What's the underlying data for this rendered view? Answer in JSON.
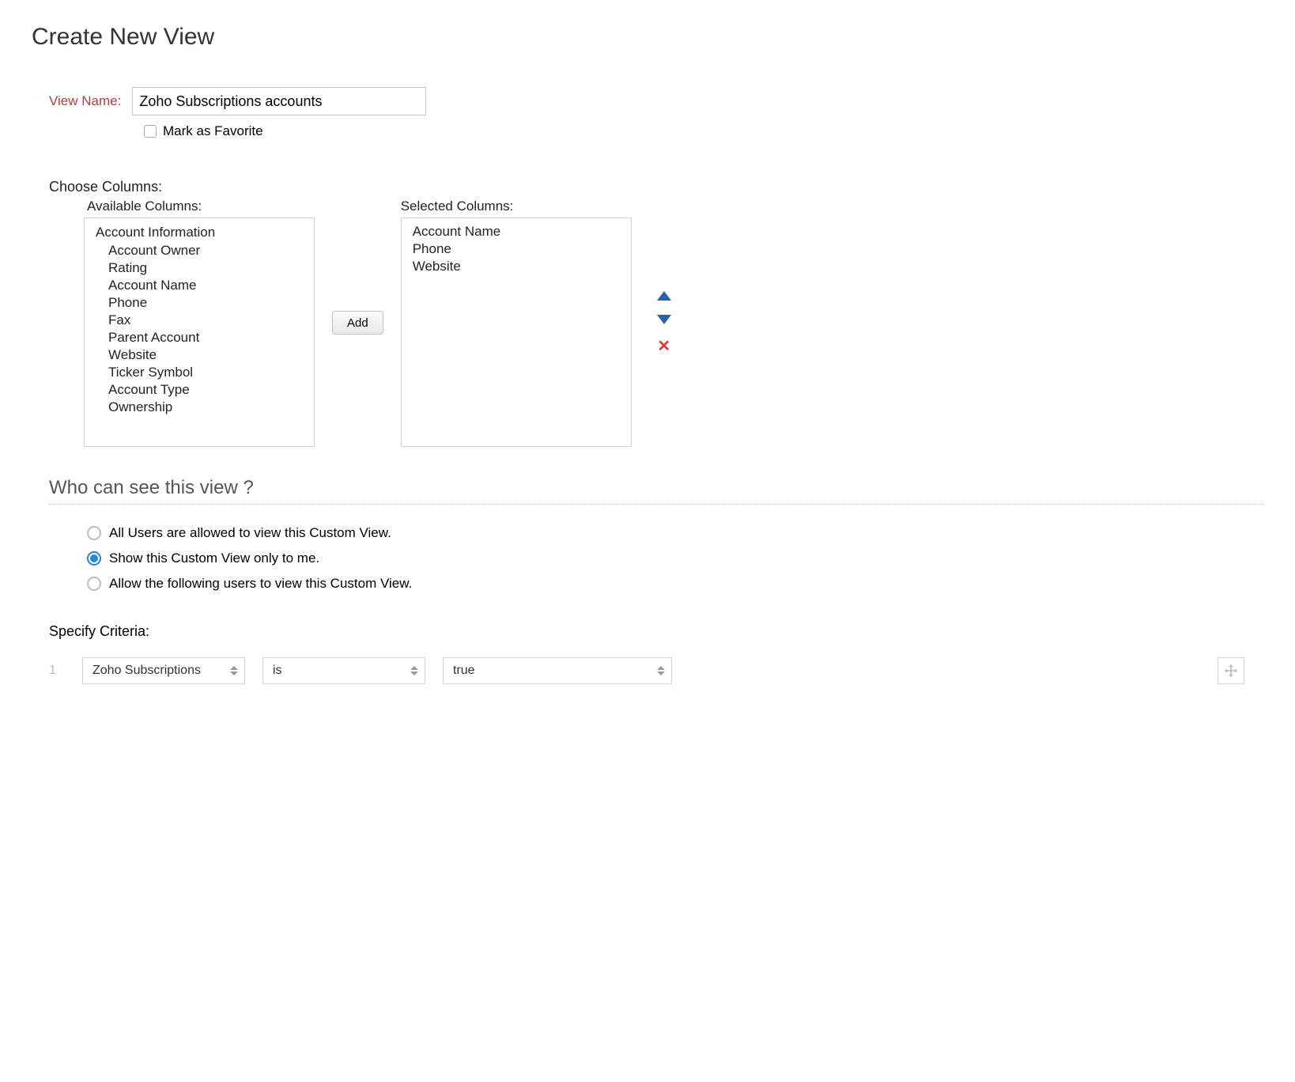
{
  "page_title": "Create New View",
  "view_name": {
    "label": "View Name:",
    "value": "Zoho Subscriptions accounts"
  },
  "favorite": {
    "label": "Mark as Favorite",
    "checked": false
  },
  "columns": {
    "section_label": "Choose Columns:",
    "available_label": "Available Columns:",
    "selected_label": "Selected Columns:",
    "available_group": "Account Information",
    "available": [
      "Account Owner",
      "Rating",
      "Account Name",
      "Phone",
      "Fax",
      "Parent Account",
      "Website",
      "Ticker Symbol",
      "Account Type",
      "Ownership"
    ],
    "selected": [
      "Account Name",
      "Phone",
      "Website"
    ],
    "add_button": "Add"
  },
  "visibility": {
    "title": "Who can see this view ?",
    "options": [
      {
        "label": "All Users are allowed to view this Custom View.",
        "checked": false
      },
      {
        "label": "Show this Custom View only to me.",
        "checked": true
      },
      {
        "label": "Allow the following users to view this Custom View.",
        "checked": false
      }
    ]
  },
  "criteria": {
    "label": "Specify Criteria:",
    "index": "1",
    "field": "Zoho Subscriptions",
    "operator": "is",
    "value": "true"
  }
}
